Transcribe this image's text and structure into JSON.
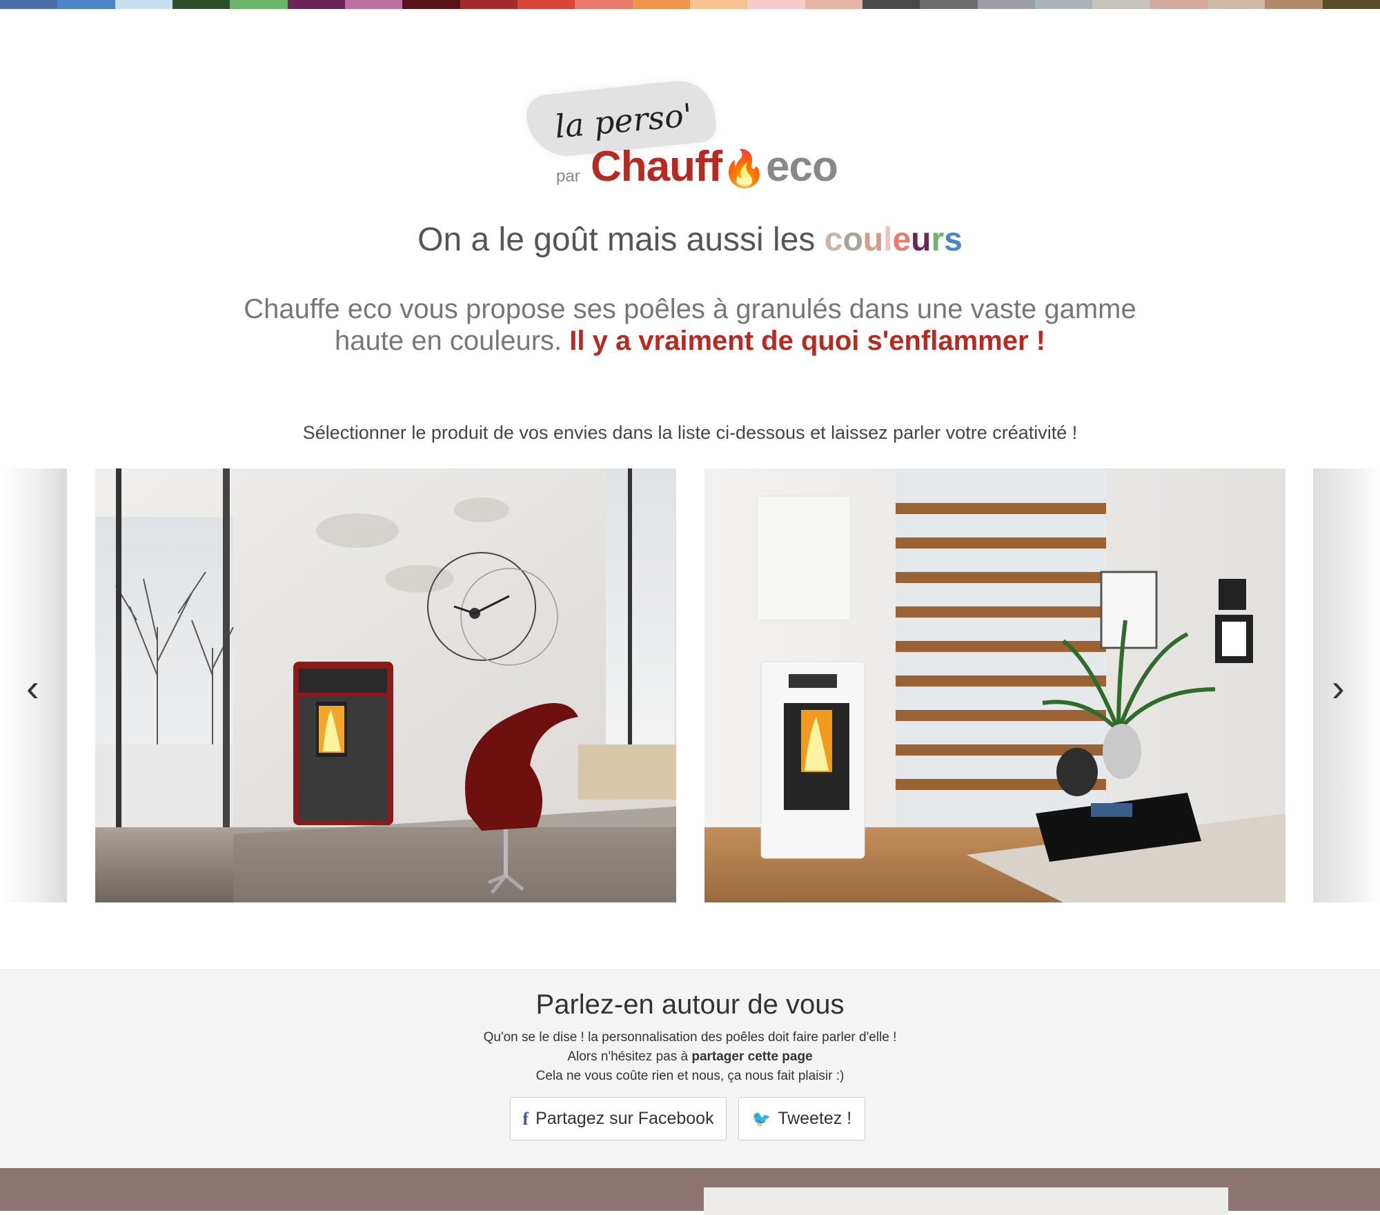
{
  "swatches": [
    "#4a6fa8",
    "#4a86c7",
    "#c9ddf0",
    "#2f4f2c",
    "#6ab56c",
    "#6b2557",
    "#be6f9f",
    "#5a1216",
    "#a3292b",
    "#d6473a",
    "#ea7a6c",
    "#f0964a",
    "#f7c393",
    "#f6cccb",
    "#e4b5a6",
    "#4a4a4a",
    "#6d6d6d",
    "#9b9ea2",
    "#a9b5b7",
    "#c7c4bc",
    "#d6a9a0",
    "#cdb9a8",
    "#b08a69",
    "#5b4f2a"
  ],
  "logo": {
    "top_text": "la perso'",
    "par": "par",
    "brand_main": "Chauff",
    "brand_eco": "eco"
  },
  "tagline": {
    "prefix": "On a le goût mais aussi les ",
    "letters": [
      {
        "ch": "c",
        "color": "#c9b5a6"
      },
      {
        "ch": "o",
        "color": "#a8a39b"
      },
      {
        "ch": "u",
        "color": "#d59a8a"
      },
      {
        "ch": "l",
        "color": "#f0c4c0"
      },
      {
        "ch": "e",
        "color": "#ea7a6c"
      },
      {
        "ch": "u",
        "color": "#6b2557"
      },
      {
        "ch": "r",
        "color": "#6ab56c"
      },
      {
        "ch": "s",
        "color": "#4a86c7"
      }
    ]
  },
  "intro": {
    "text": "Chauffe eco vous propose ses poêles à granulés dans une vaste gamme haute en couleurs. ",
    "highlight": "Il y a vraiment de quoi s'enflammer !"
  },
  "select_text": "Sélectionner le produit de vos envies dans la liste ci-dessous et laissez parler votre créativité !",
  "carousel": {
    "prev_icon": "‹",
    "next_icon": "›"
  },
  "share": {
    "title": "Parlez-en autour de vous",
    "line1": "Qu'on se le dise ! la personnalisation des poêles doit faire parler d'elle !",
    "line2_prefix": "Alors n'hésitez pas à ",
    "line2_bold": "partager cette page",
    "line3": "Cela ne vous coûte rien et nous, ça nous fait plaisir :)",
    "facebook_label": "Partagez sur Facebook",
    "twitter_label": "Tweetez !",
    "facebook_icon": "f",
    "twitter_icon": "🐦"
  },
  "colors": {
    "accent": "#b52a21",
    "footer": "#8c7570"
  }
}
